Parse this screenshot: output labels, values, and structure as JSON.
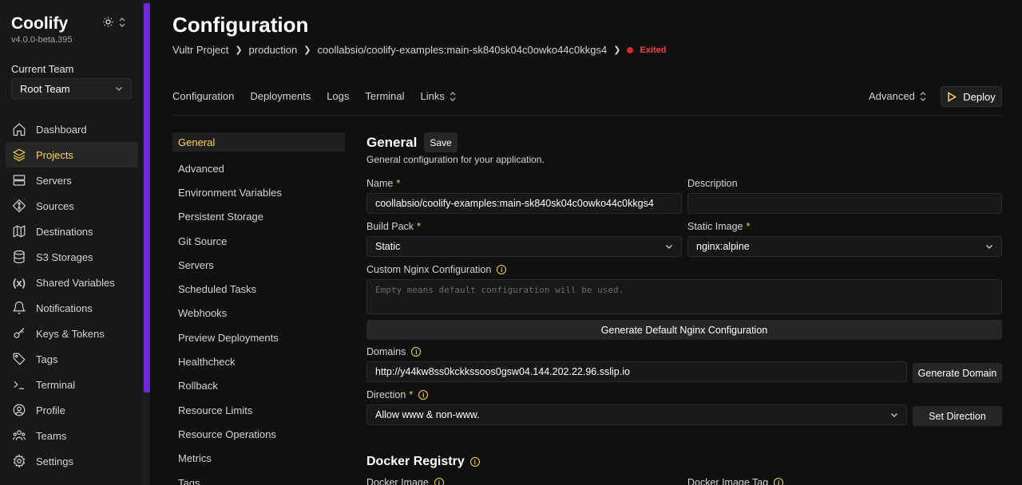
{
  "app": {
    "name": "Coolify",
    "version": "v4.0.0-beta.395"
  },
  "team": {
    "label": "Current Team",
    "selected": "Root Team"
  },
  "nav": [
    {
      "label": "Dashboard",
      "icon": "home-icon"
    },
    {
      "label": "Projects",
      "icon": "layers-icon",
      "active": true
    },
    {
      "label": "Servers",
      "icon": "server-icon"
    },
    {
      "label": "Sources",
      "icon": "git-icon"
    },
    {
      "label": "Destinations",
      "icon": "destination-icon"
    },
    {
      "label": "S3 Storages",
      "icon": "database-icon"
    },
    {
      "label": "Shared Variables",
      "icon": "variable-icon"
    },
    {
      "label": "Notifications",
      "icon": "bell-icon"
    },
    {
      "label": "Keys & Tokens",
      "icon": "key-icon"
    },
    {
      "label": "Tags",
      "icon": "tag-icon"
    },
    {
      "label": "Terminal",
      "icon": "terminal-icon"
    },
    {
      "label": "Profile",
      "icon": "user-icon"
    },
    {
      "label": "Teams",
      "icon": "team-icon"
    },
    {
      "label": "Settings",
      "icon": "gear-icon"
    }
  ],
  "page": {
    "title": "Configuration",
    "breadcrumb": [
      "Vultr Project",
      "production",
      "coollabsio/coolify-examples:main-sk840sk04c0owko44c0kkgs4"
    ],
    "status": "Exited"
  },
  "tabs": [
    "Configuration",
    "Deployments",
    "Logs",
    "Terminal",
    "Links"
  ],
  "actions": {
    "advanced": "Advanced",
    "deploy": "Deploy"
  },
  "subnav": [
    "General",
    "Advanced",
    "Environment Variables",
    "Persistent Storage",
    "Git Source",
    "Servers",
    "Scheduled Tasks",
    "Webhooks",
    "Preview Deployments",
    "Healthcheck",
    "Rollback",
    "Resource Limits",
    "Resource Operations",
    "Metrics",
    "Tags"
  ],
  "general": {
    "title": "General",
    "save": "Save",
    "subtitle": "General configuration for your application.",
    "name_label": "Name",
    "name_value": "coollabsio/coolify-examples:main-sk840sk04c0owko44c0kkgs4",
    "description_label": "Description",
    "description_value": "",
    "build_pack_label": "Build Pack",
    "build_pack_value": "Static",
    "static_image_label": "Static Image",
    "static_image_value": "nginx:alpine",
    "nginx_label": "Custom Nginx Configuration",
    "nginx_placeholder": "Empty means default configuration will be used.",
    "generate_nginx": "Generate Default Nginx Configuration",
    "domains_label": "Domains",
    "domains_value": "http://y44kw8ss0kckkssoos0gsw04.144.202.22.96.sslip.io",
    "generate_domain": "Generate Domain",
    "direction_label": "Direction",
    "direction_value": "Allow www & non-www.",
    "set_direction": "Set Direction"
  },
  "docker": {
    "title": "Docker Registry",
    "image_label": "Docker Image",
    "tag_label": "Docker Image Tag"
  },
  "colors": {
    "accent": "#fcd452",
    "purple": "#6d28d9",
    "error": "#ef4444"
  }
}
